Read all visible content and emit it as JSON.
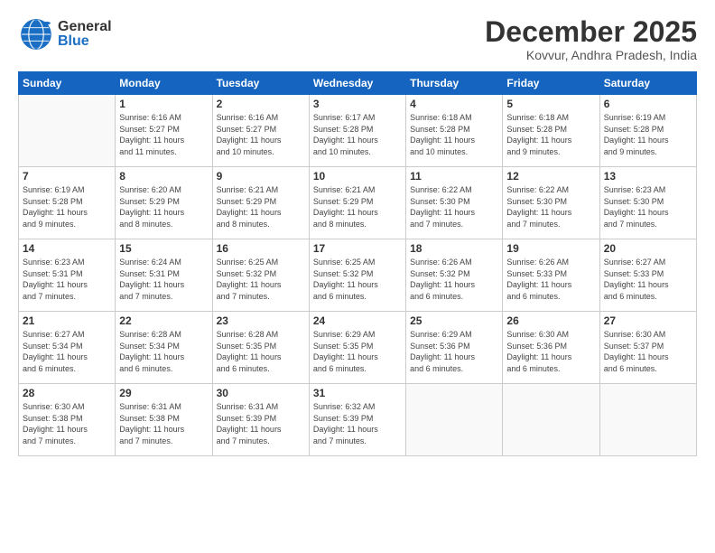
{
  "header": {
    "logo": {
      "general": "General",
      "blue": "Blue"
    },
    "title": "December 2025",
    "location": "Kovvur, Andhra Pradesh, India"
  },
  "days_of_week": [
    "Sunday",
    "Monday",
    "Tuesday",
    "Wednesday",
    "Thursday",
    "Friday",
    "Saturday"
  ],
  "weeks": [
    [
      {
        "day": "",
        "info": ""
      },
      {
        "day": "1",
        "info": "Sunrise: 6:16 AM\nSunset: 5:27 PM\nDaylight: 11 hours\nand 11 minutes."
      },
      {
        "day": "2",
        "info": "Sunrise: 6:16 AM\nSunset: 5:27 PM\nDaylight: 11 hours\nand 10 minutes."
      },
      {
        "day": "3",
        "info": "Sunrise: 6:17 AM\nSunset: 5:28 PM\nDaylight: 11 hours\nand 10 minutes."
      },
      {
        "day": "4",
        "info": "Sunrise: 6:18 AM\nSunset: 5:28 PM\nDaylight: 11 hours\nand 10 minutes."
      },
      {
        "day": "5",
        "info": "Sunrise: 6:18 AM\nSunset: 5:28 PM\nDaylight: 11 hours\nand 9 minutes."
      },
      {
        "day": "6",
        "info": "Sunrise: 6:19 AM\nSunset: 5:28 PM\nDaylight: 11 hours\nand 9 minutes."
      }
    ],
    [
      {
        "day": "7",
        "info": "Sunrise: 6:19 AM\nSunset: 5:28 PM\nDaylight: 11 hours\nand 9 minutes."
      },
      {
        "day": "8",
        "info": "Sunrise: 6:20 AM\nSunset: 5:29 PM\nDaylight: 11 hours\nand 8 minutes."
      },
      {
        "day": "9",
        "info": "Sunrise: 6:21 AM\nSunset: 5:29 PM\nDaylight: 11 hours\nand 8 minutes."
      },
      {
        "day": "10",
        "info": "Sunrise: 6:21 AM\nSunset: 5:29 PM\nDaylight: 11 hours\nand 8 minutes."
      },
      {
        "day": "11",
        "info": "Sunrise: 6:22 AM\nSunset: 5:30 PM\nDaylight: 11 hours\nand 7 minutes."
      },
      {
        "day": "12",
        "info": "Sunrise: 6:22 AM\nSunset: 5:30 PM\nDaylight: 11 hours\nand 7 minutes."
      },
      {
        "day": "13",
        "info": "Sunrise: 6:23 AM\nSunset: 5:30 PM\nDaylight: 11 hours\nand 7 minutes."
      }
    ],
    [
      {
        "day": "14",
        "info": "Sunrise: 6:23 AM\nSunset: 5:31 PM\nDaylight: 11 hours\nand 7 minutes."
      },
      {
        "day": "15",
        "info": "Sunrise: 6:24 AM\nSunset: 5:31 PM\nDaylight: 11 hours\nand 7 minutes."
      },
      {
        "day": "16",
        "info": "Sunrise: 6:25 AM\nSunset: 5:32 PM\nDaylight: 11 hours\nand 7 minutes."
      },
      {
        "day": "17",
        "info": "Sunrise: 6:25 AM\nSunset: 5:32 PM\nDaylight: 11 hours\nand 6 minutes."
      },
      {
        "day": "18",
        "info": "Sunrise: 6:26 AM\nSunset: 5:32 PM\nDaylight: 11 hours\nand 6 minutes."
      },
      {
        "day": "19",
        "info": "Sunrise: 6:26 AM\nSunset: 5:33 PM\nDaylight: 11 hours\nand 6 minutes."
      },
      {
        "day": "20",
        "info": "Sunrise: 6:27 AM\nSunset: 5:33 PM\nDaylight: 11 hours\nand 6 minutes."
      }
    ],
    [
      {
        "day": "21",
        "info": "Sunrise: 6:27 AM\nSunset: 5:34 PM\nDaylight: 11 hours\nand 6 minutes."
      },
      {
        "day": "22",
        "info": "Sunrise: 6:28 AM\nSunset: 5:34 PM\nDaylight: 11 hours\nand 6 minutes."
      },
      {
        "day": "23",
        "info": "Sunrise: 6:28 AM\nSunset: 5:35 PM\nDaylight: 11 hours\nand 6 minutes."
      },
      {
        "day": "24",
        "info": "Sunrise: 6:29 AM\nSunset: 5:35 PM\nDaylight: 11 hours\nand 6 minutes."
      },
      {
        "day": "25",
        "info": "Sunrise: 6:29 AM\nSunset: 5:36 PM\nDaylight: 11 hours\nand 6 minutes."
      },
      {
        "day": "26",
        "info": "Sunrise: 6:30 AM\nSunset: 5:36 PM\nDaylight: 11 hours\nand 6 minutes."
      },
      {
        "day": "27",
        "info": "Sunrise: 6:30 AM\nSunset: 5:37 PM\nDaylight: 11 hours\nand 6 minutes."
      }
    ],
    [
      {
        "day": "28",
        "info": "Sunrise: 6:30 AM\nSunset: 5:38 PM\nDaylight: 11 hours\nand 7 minutes."
      },
      {
        "day": "29",
        "info": "Sunrise: 6:31 AM\nSunset: 5:38 PM\nDaylight: 11 hours\nand 7 minutes."
      },
      {
        "day": "30",
        "info": "Sunrise: 6:31 AM\nSunset: 5:39 PM\nDaylight: 11 hours\nand 7 minutes."
      },
      {
        "day": "31",
        "info": "Sunrise: 6:32 AM\nSunset: 5:39 PM\nDaylight: 11 hours\nand 7 minutes."
      },
      {
        "day": "",
        "info": ""
      },
      {
        "day": "",
        "info": ""
      },
      {
        "day": "",
        "info": ""
      }
    ]
  ]
}
